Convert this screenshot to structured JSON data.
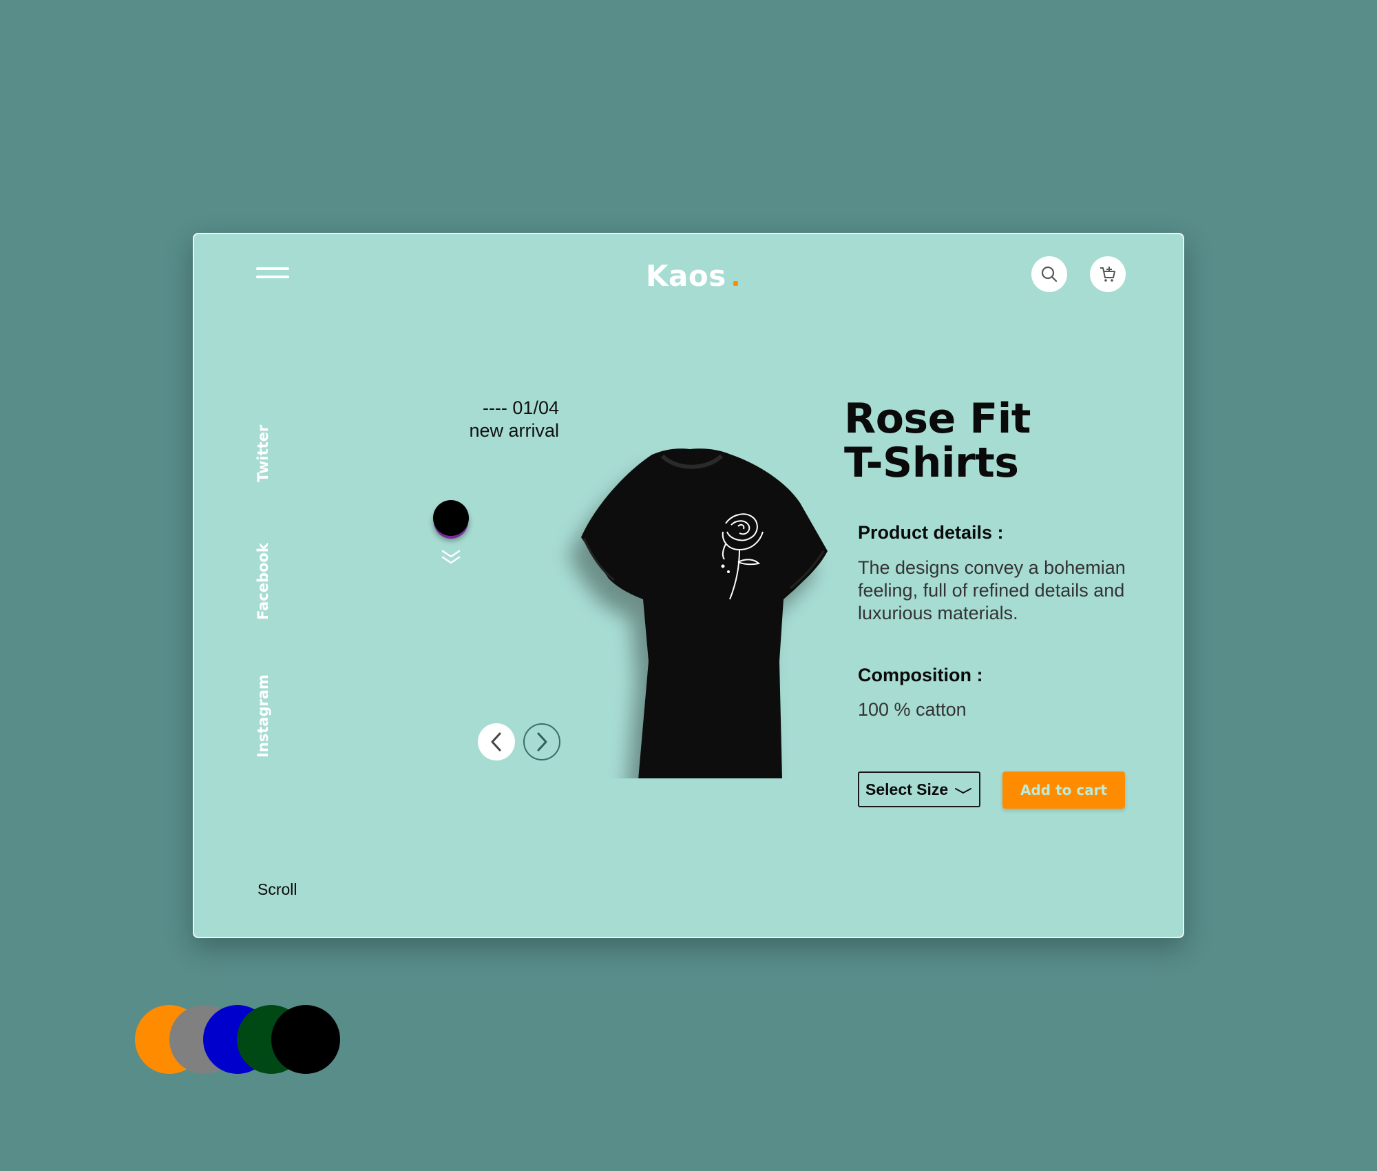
{
  "header": {
    "logo": "Kaos",
    "logo_dot_color": "#ff8c00",
    "menu_icon": "hamburger-menu-icon",
    "search_icon": "search-icon",
    "cart_icon": "cart-add-icon"
  },
  "social": {
    "twitter": "Twitter",
    "facebook": "Facebook",
    "instagram": "Instagram"
  },
  "slider": {
    "counter": "---- 01/04",
    "tag": "new arrival",
    "selected_color": "#000000"
  },
  "product": {
    "title_line1": "Rose Fit",
    "title_line2": "T-Shirts",
    "details_label": "Product details :",
    "description": "The designs convey a bohemian feeling, full of refined details and luxurious materials.",
    "composition_label": "Composition :",
    "composition_value": "100 % catton",
    "size_placeholder": "Select Size",
    "add_to_cart": "Add to cart"
  },
  "footer": {
    "scroll_label": "Scroll"
  },
  "palette": {
    "colors": [
      "#ff8c00",
      "#808080",
      "#0000cc",
      "#004814",
      "#000000"
    ]
  }
}
